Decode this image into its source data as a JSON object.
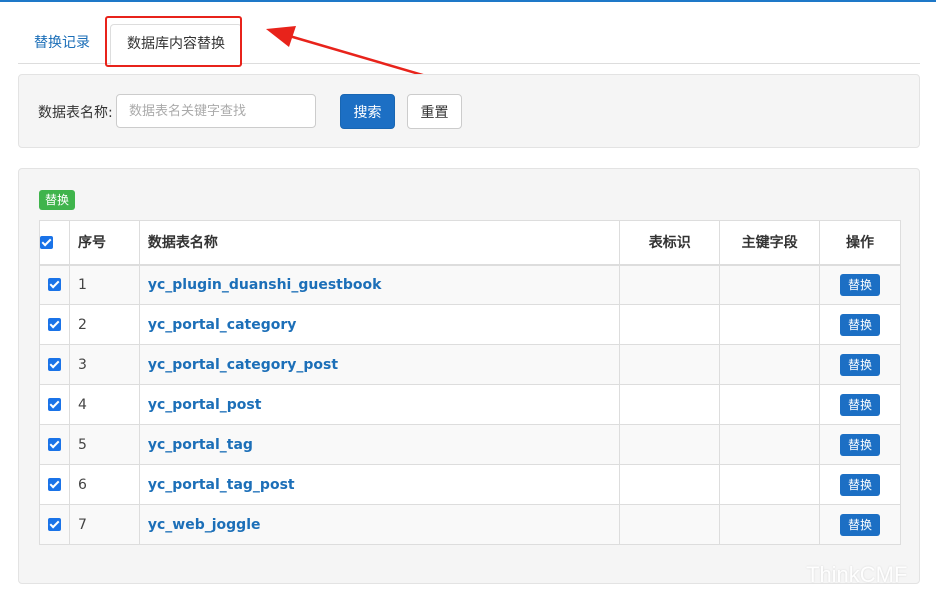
{
  "colors": {
    "accent": "#1c6fc4",
    "link": "#1c6fb8",
    "success": "#3fb44c",
    "annotation": "#e8231b"
  },
  "tabs": [
    {
      "label": "替换记录",
      "active": false
    },
    {
      "label": "数据库内容替换",
      "active": true
    }
  ],
  "search": {
    "label": "数据表名称:",
    "placeholder": "数据表名关键字查找",
    "value": "",
    "search_button": "搜索",
    "reset_button": "重置"
  },
  "main": {
    "bulk_replace_label": "替换",
    "columns": [
      "序号",
      "数据表名称",
      "表标识",
      "主键字段",
      "操作"
    ],
    "rows": [
      {
        "no": "1",
        "name": "yc_plugin_duanshi_guestbook",
        "flag": "",
        "pk": "",
        "action": "替换",
        "checked": true
      },
      {
        "no": "2",
        "name": "yc_portal_category",
        "flag": "",
        "pk": "",
        "action": "替换",
        "checked": true
      },
      {
        "no": "3",
        "name": "yc_portal_category_post",
        "flag": "",
        "pk": "",
        "action": "替换",
        "checked": true
      },
      {
        "no": "4",
        "name": "yc_portal_post",
        "flag": "",
        "pk": "",
        "action": "替换",
        "checked": true
      },
      {
        "no": "5",
        "name": "yc_portal_tag",
        "flag": "",
        "pk": "",
        "action": "替换",
        "checked": true
      },
      {
        "no": "6",
        "name": "yc_portal_tag_post",
        "flag": "",
        "pk": "",
        "action": "替换",
        "checked": true
      },
      {
        "no": "7",
        "name": "yc_web_joggle",
        "flag": "",
        "pk": "",
        "action": "替换",
        "checked": true
      }
    ]
  },
  "watermark": "ThinkCMF"
}
